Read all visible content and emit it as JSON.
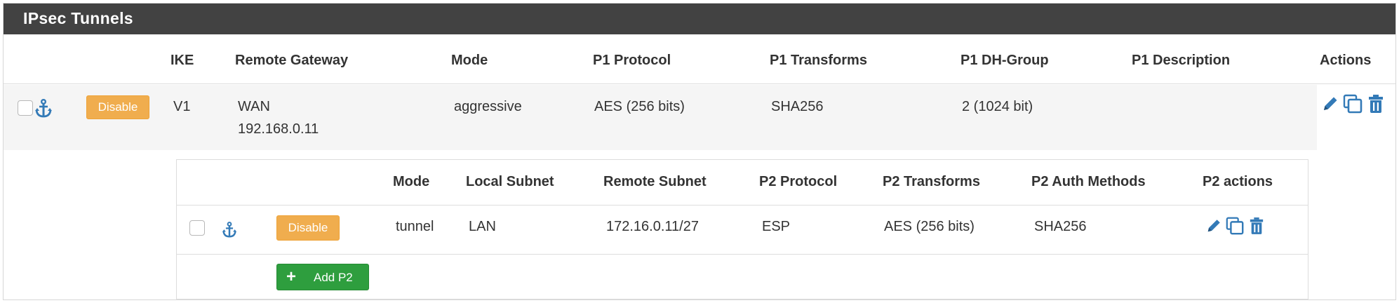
{
  "panel": {
    "title": "IPsec Tunnels"
  },
  "p1": {
    "headers": [
      "IKE",
      "Remote Gateway",
      "Mode",
      "P1 Protocol",
      "P1 Transforms",
      "P1 DH-Group",
      "P1 Description",
      "Actions"
    ],
    "row": {
      "disable_label": "Disable",
      "ike": "V1",
      "gateway_interface": "WAN",
      "gateway_ip": "192.168.0.11",
      "mode": "aggressive",
      "protocol": "AES (256 bits)",
      "transforms": "SHA256",
      "dh_group": "2 (1024 bit)",
      "description": ""
    }
  },
  "p2": {
    "headers": [
      "Mode",
      "Local Subnet",
      "Remote Subnet",
      "P2 Protocol",
      "P2 Transforms",
      "P2 Auth Methods",
      "P2 actions"
    ],
    "row": {
      "disable_label": "Disable",
      "mode": "tunnel",
      "local_subnet": "LAN",
      "remote_subnet": "172.16.0.11/27",
      "protocol": "ESP",
      "transforms": "AES (256 bits)",
      "auth_methods": "SHA256"
    },
    "add_label": "Add P2"
  },
  "icons": {
    "anchor": "anchor-icon",
    "edit": "pencil-icon",
    "copy": "copy-icon",
    "delete": "trash-icon",
    "add": "plus-icon"
  },
  "colors": {
    "header_bg": "#424242",
    "disable_btn": "#f0ad4e",
    "add_btn": "#2e9e3e",
    "icon_blue": "#337ab7",
    "row_bg": "#f5f5f5"
  }
}
